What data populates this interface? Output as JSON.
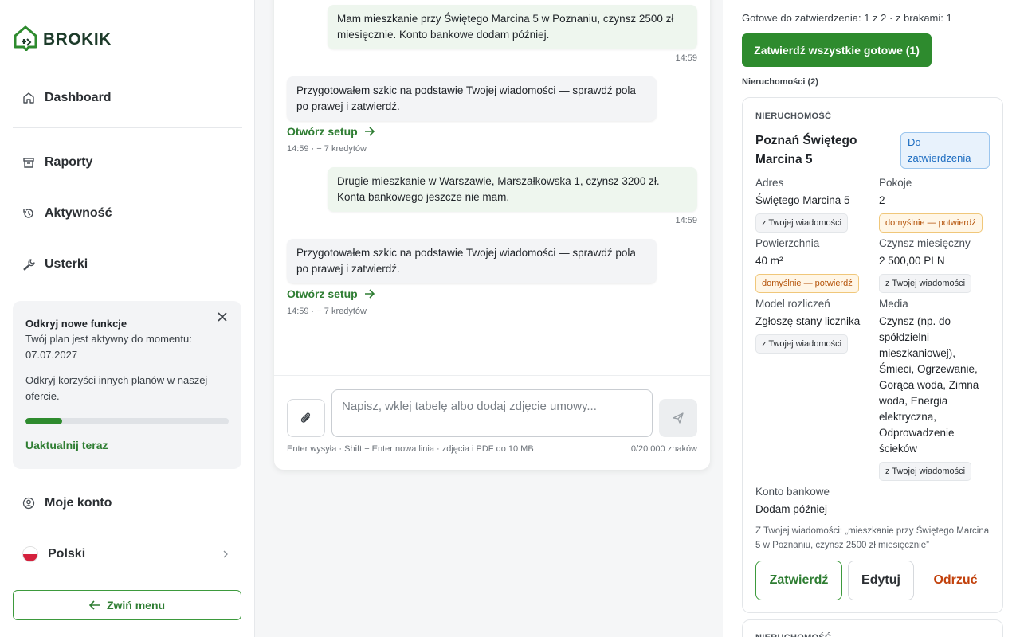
{
  "app": {
    "logo_text": "BROKIK"
  },
  "colors": {
    "brand_green": "#2e8b2e",
    "status_blue": "#1c6cc0",
    "warning_orange": "#b45309",
    "reject_red": "#c2410c"
  },
  "sidebar": {
    "items": [
      {
        "label": "Dashboard",
        "icon": "home-icon"
      },
      {
        "label": "Raporty",
        "icon": "archive-icon"
      },
      {
        "label": "Aktywność",
        "icon": "history-icon"
      },
      {
        "label": "Usterki",
        "icon": "wrench-icon"
      }
    ],
    "promo": {
      "title": "Odkryj nowe funkcje",
      "text": "Twój plan jest aktywny do momentu: 07.07.2027",
      "text2": "Odkryj korzyści innych planów w naszej ofercie.",
      "progress": 0.18,
      "link": "Uaktualnij teraz"
    },
    "account_label": "Moje konto",
    "language_label": "Polski",
    "collapse_label": "Zwiń menu"
  },
  "chat": {
    "messages": [
      {
        "role": "user",
        "text": "Mam mieszkanie przy Świętego Marcina 5 w Poznaniu, czynsz 2500 zł miesięcznie. Konto bankowe dodam później.",
        "time": "14:59"
      },
      {
        "role": "bot",
        "text": "Przygotowałem szkic na podstawie Twojej wiadomości — sprawdź pola po prawej i zatwierdź.",
        "action": "Otwórz setup",
        "meta": "14:59 · − 7 kredytów"
      },
      {
        "role": "user",
        "text": "Drugie mieszkanie w Warszawie, Marszałkowska 1, czynsz 3200 zł. Konta bankowego jeszcze nie mam.",
        "time": "14:59"
      },
      {
        "role": "bot",
        "text": "Przygotowałem szkic na podstawie Twojej wiadomości — sprawdź pola po prawej i zatwierdź.",
        "action": "Otwórz setup",
        "meta": "14:59 · − 7 kredytów"
      }
    ],
    "composer": {
      "placeholder": "Napisz, wklej tabelę albo dodaj zdjęcie umowy...",
      "value": "",
      "hint": "Enter wysyła · Shift + Enter nowa linia · zdjęcia i PDF do 10 MB",
      "counter": "0/20 000 znaków"
    }
  },
  "panel": {
    "ready_line": "Gotowe do zatwierdzenia: 1 z 2 · z brakami: 1",
    "approve_all_label": "Zatwierdź wszystkie gotowe (1)",
    "section_label": "Nieruchomości (2)",
    "property": {
      "kind": "NIERUCHOMOŚĆ",
      "title": "Poznań Świętego Marcina 5",
      "status": "Do zatwierdzenia",
      "fields": {
        "address": {
          "label": "Adres",
          "value": "Świętego Marcina 5",
          "tag": "z Twojej wiadomości"
        },
        "rooms": {
          "label": "Pokoje",
          "value": "2",
          "tag": "domyślnie — potwierdź"
        },
        "area": {
          "label": "Powierzchnia",
          "value": "40 m²",
          "tag": "domyślnie — potwierdź"
        },
        "rent": {
          "label": "Czynsz miesięczny",
          "value": "2 500,00 PLN",
          "tag": "z Twojej wiadomości"
        },
        "billing": {
          "label": "Model rozliczeń",
          "value": "Zgłoszę stany licznika",
          "tag": "z Twojej wiadomości"
        },
        "media": {
          "label": "Media",
          "value": "Czynsz (np. do spółdzielni mieszkaniowej), Śmieci, Ogrzewanie, Gorąca woda, Zimna woda, Energia elektryczna, Odprowadzenie ścieków",
          "tag": "z Twojej wiadomości"
        },
        "bank": {
          "label": "Konto bankowe",
          "value": "Dodam później"
        }
      },
      "quote": "Z Twojej wiadomości: „mieszkanie przy Świętego Marcina 5 w Poznaniu, czynsz 2500 zł miesięcznie”",
      "approve_label": "Zatwierdź",
      "edit_label": "Edytuj",
      "reject_label": "Odrzuć"
    },
    "property2": {
      "kind": "NIERUCHOMOŚĆ"
    }
  }
}
